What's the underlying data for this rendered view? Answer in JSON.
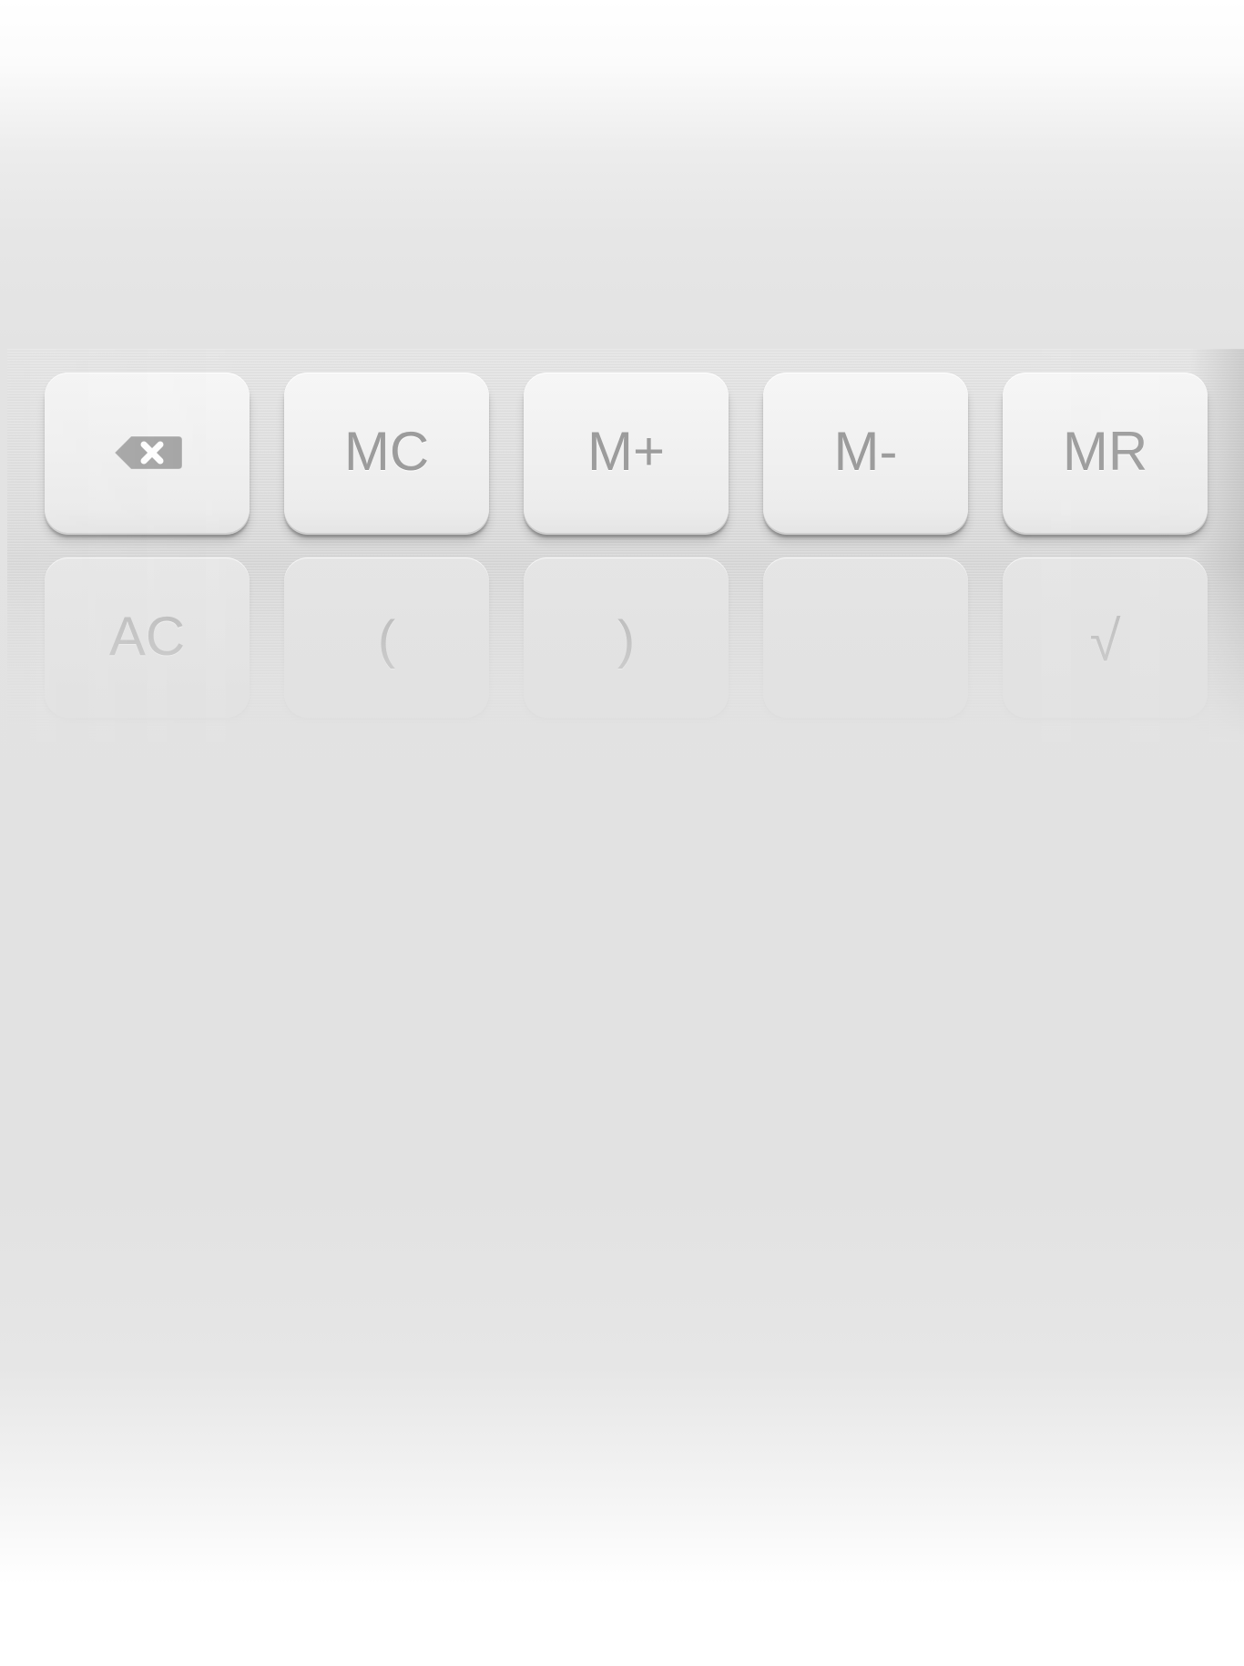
{
  "keypad": {
    "row1": {
      "backspace": {
        "icon": "backspace-icon"
      },
      "mc": "MC",
      "m_plus": "M+",
      "m_minus": "M-",
      "mr": "MR"
    },
    "row2": {
      "ac": "AC",
      "open_paren": "(",
      "close_paren": ")",
      "blank": "",
      "sqrt": "√"
    }
  },
  "colors": {
    "key_label": "#9c9c9c",
    "key_face": "#f1f1f1",
    "background": "#e2e2e2"
  }
}
